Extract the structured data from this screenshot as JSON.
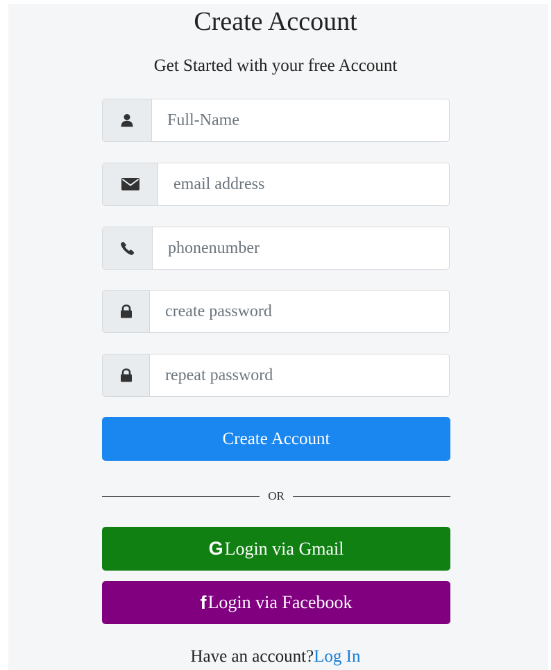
{
  "header": {
    "title": "Create Account",
    "subtitle": "Get Started with your free Account"
  },
  "form": {
    "fields": [
      {
        "name": "full-name",
        "icon": "user-icon",
        "placeholder": "Full-Name",
        "value": ""
      },
      {
        "name": "email",
        "icon": "envelope-icon",
        "placeholder": "email address",
        "value": ""
      },
      {
        "name": "phone",
        "icon": "phone-icon",
        "placeholder": "phonenumber",
        "value": ""
      },
      {
        "name": "password",
        "icon": "lock-icon",
        "placeholder": "create password",
        "value": ""
      },
      {
        "name": "repeat-password",
        "icon": "lock-icon",
        "placeholder": "repeat password",
        "value": ""
      }
    ],
    "submit_label": "Create Account"
  },
  "divider": {
    "label": "OR"
  },
  "social": {
    "gmail_glyph": "G",
    "gmail_label": "Login via Gmail",
    "facebook_glyph": "f",
    "facebook_label": "Login via Facebook"
  },
  "footer": {
    "prompt": "Have an account?",
    "login_link": "Log In"
  },
  "colors": {
    "primary": "#1a86f0",
    "gmail": "#108012",
    "facebook": "#800080",
    "link": "#1a7fd6",
    "addon_bg": "#e9ecef"
  }
}
